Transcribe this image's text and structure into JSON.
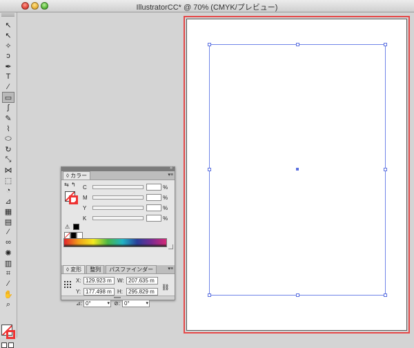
{
  "window": {
    "title": "IllustratorCC* @ 70% (CMYK/プレビュー)"
  },
  "toolbar": {
    "tools": [
      {
        "name": "selection-tool-icon",
        "glyph": "↖"
      },
      {
        "name": "direct-selection-tool-icon",
        "glyph": "↖"
      },
      {
        "name": "magic-wand-tool-icon",
        "glyph": "✧"
      },
      {
        "name": "lasso-tool-icon",
        "glyph": "ↄ"
      },
      {
        "name": "pen-tool-icon",
        "glyph": "✒"
      },
      {
        "name": "type-tool-icon",
        "glyph": "T"
      },
      {
        "name": "line-tool-icon",
        "glyph": "∕"
      },
      {
        "name": "rectangle-tool-icon",
        "glyph": "▭"
      },
      {
        "name": "paintbrush-tool-icon",
        "glyph": "∫"
      },
      {
        "name": "pencil-tool-icon",
        "glyph": "✎"
      },
      {
        "name": "blob-brush-tool-icon",
        "glyph": "⌇"
      },
      {
        "name": "eraser-tool-icon",
        "glyph": "⬭"
      },
      {
        "name": "rotate-tool-icon",
        "glyph": "↻"
      },
      {
        "name": "scale-tool-icon",
        "glyph": "⤡"
      },
      {
        "name": "width-tool-icon",
        "glyph": "⋈"
      },
      {
        "name": "free-transform-tool-icon",
        "glyph": "⬚"
      },
      {
        "name": "shape-builder-tool-icon",
        "glyph": "◔"
      },
      {
        "name": "perspective-grid-tool-icon",
        "glyph": "⊿"
      },
      {
        "name": "mesh-tool-icon",
        "glyph": "▦"
      },
      {
        "name": "gradient-tool-icon",
        "glyph": "▤"
      },
      {
        "name": "eyedropper-tool-icon",
        "glyph": "⁄"
      },
      {
        "name": "blend-tool-icon",
        "glyph": "∞"
      },
      {
        "name": "symbol-sprayer-tool-icon",
        "glyph": "✺"
      },
      {
        "name": "column-graph-tool-icon",
        "glyph": "▥"
      },
      {
        "name": "artboard-tool-icon",
        "glyph": "⌗"
      },
      {
        "name": "slice-tool-icon",
        "glyph": "⁄"
      },
      {
        "name": "hand-tool-icon",
        "glyph": "✋"
      },
      {
        "name": "zoom-tool-icon",
        "glyph": "⌕"
      }
    ],
    "selected_tool": "rectangle-tool-icon"
  },
  "color_panel": {
    "tab_label": "◊ カラー",
    "channels": [
      {
        "label": "C",
        "value": "",
        "unit": "%"
      },
      {
        "label": "M",
        "value": "",
        "unit": "%"
      },
      {
        "label": "Y",
        "value": "",
        "unit": "%"
      },
      {
        "label": "K",
        "value": "",
        "unit": "%"
      }
    ]
  },
  "transform_panel": {
    "tabs": [
      "◊ 変形",
      "整列",
      "パスファインダー"
    ],
    "x_label": "X:",
    "x_value": "129.923 m",
    "y_label": "Y:",
    "y_value": "177.498 m",
    "w_label": "W:",
    "w_value": "207.635 m",
    "h_label": "H:",
    "h_value": "295.829 m",
    "rotate_label": "⊿:",
    "rotate_value": "0°",
    "shear_label": "⊘:",
    "shear_value": "0°"
  }
}
